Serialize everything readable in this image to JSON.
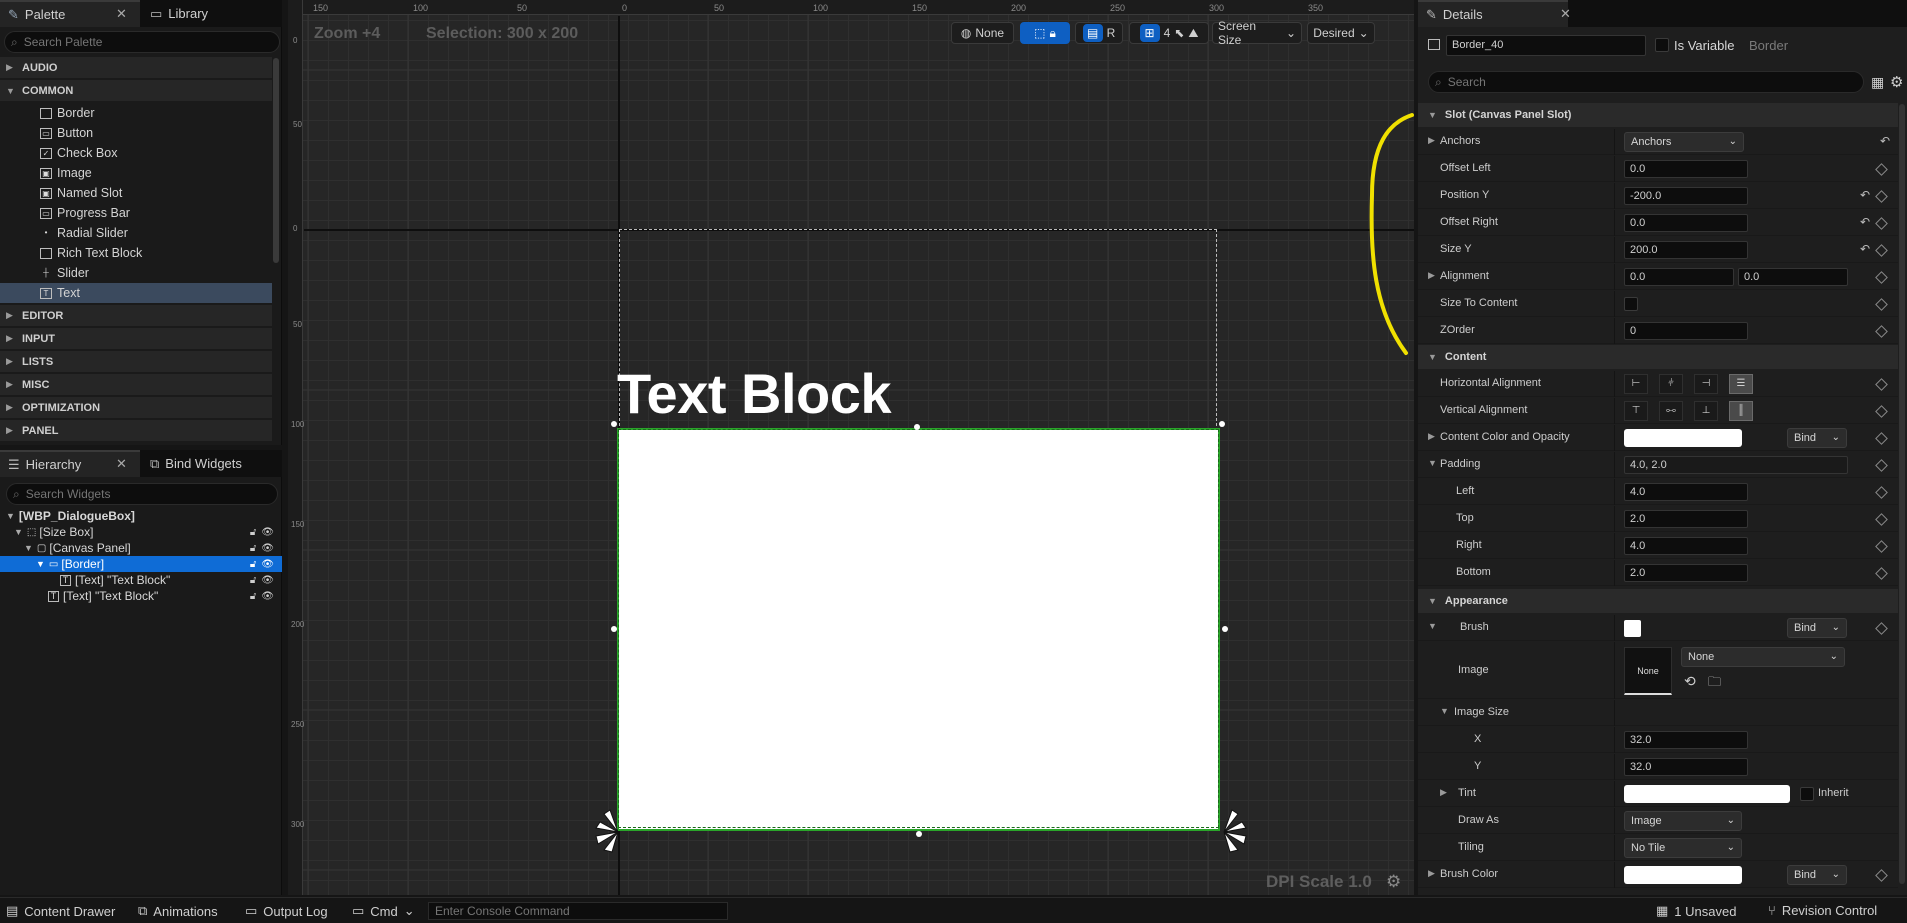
{
  "palette": {
    "tab_label": "Palette",
    "library_tab_label": "Library",
    "search_placeholder": "Search Palette",
    "categories_top": [
      "AUDIO",
      "COMMON"
    ],
    "common_items": [
      {
        "label": "Border",
        "icon": "border-icon"
      },
      {
        "label": "Button",
        "icon": "button-icon"
      },
      {
        "label": "Check Box",
        "icon": "checkbox-icon"
      },
      {
        "label": "Image",
        "icon": "image-icon"
      },
      {
        "label": "Named Slot",
        "icon": "named-slot-icon"
      },
      {
        "label": "Progress Bar",
        "icon": "progress-bar-icon"
      },
      {
        "label": "Radial Slider",
        "icon": "radial-slider-icon"
      },
      {
        "label": "Rich Text Block",
        "icon": "rich-text-icon"
      },
      {
        "label": "Slider",
        "icon": "slider-icon"
      },
      {
        "label": "Text",
        "icon": "text-icon"
      }
    ],
    "categories_bottom": [
      "EDITOR",
      "INPUT",
      "LISTS",
      "MISC",
      "OPTIMIZATION",
      "PANEL"
    ]
  },
  "hierarchy": {
    "tab_label": "Hierarchy",
    "bind_tab_label": "Bind Widgets",
    "search_placeholder": "Search Widgets",
    "rows": [
      {
        "label": "[WBP_DialogueBox]"
      },
      {
        "label": "[Size Box]"
      },
      {
        "label": "[Canvas Panel]"
      },
      {
        "label": "[Border]"
      },
      {
        "label": "[Text] \"Text Block\""
      },
      {
        "label": "[Text] \"Text Block\""
      }
    ]
  },
  "viewport": {
    "zoom": "Zoom +4",
    "selection": "Selection: 300 x 200",
    "ruler_top": [
      "150",
      "100",
      "50",
      "0",
      "50",
      "100",
      "150",
      "200",
      "250",
      "300",
      "350"
    ],
    "ruler_left": [
      "0",
      "50",
      "0",
      "50",
      "100",
      "150",
      "200",
      "250",
      "300"
    ],
    "toolbar": {
      "none_label": "None",
      "r_label": "R",
      "grid_value": "4",
      "screen_size": "Screen Size",
      "desired": "Desired"
    },
    "canvas_text": "Text Block",
    "dpi_scale": "DPI Scale 1.0"
  },
  "details": {
    "tab_label": "Details",
    "name_value": "Border_40",
    "is_variable_label": "Is Variable",
    "class_label": "Border",
    "search_placeholder": "Search",
    "slot_section": "Slot (Canvas Panel Slot)",
    "slot_rows": [
      {
        "label": "Anchors",
        "value": "Anchors"
      },
      {
        "label": "Offset Left",
        "value": "0.0"
      },
      {
        "label": "Position Y",
        "value": "-200.0"
      },
      {
        "label": "Offset Right",
        "value": "0.0"
      },
      {
        "label": "Size Y",
        "value": "200.0"
      },
      {
        "label": "Alignment",
        "value": "0.0",
        "value2": "0.0"
      },
      {
        "label": "Size To Content",
        "value": ""
      },
      {
        "label": "ZOrder",
        "value": "0"
      }
    ],
    "content_section": "Content",
    "content_rows": [
      {
        "label": "Horizontal Alignment"
      },
      {
        "label": "Vertical Alignment"
      },
      {
        "label": "Content Color and Opacity",
        "bind": "Bind"
      },
      {
        "label": "Padding",
        "value": "4.0, 2.0"
      },
      {
        "label": "Left",
        "value": "4.0"
      },
      {
        "label": "Top",
        "value": "2.0"
      },
      {
        "label": "Right",
        "value": "4.0"
      },
      {
        "label": "Bottom",
        "value": "2.0"
      }
    ],
    "appearance_section": "Appearance",
    "appearance_rows": {
      "brush_label": "Brush",
      "brush_bind": "Bind",
      "image_label": "Image",
      "image_thumb": "None",
      "image_combo": "None",
      "image_size_label": "Image Size",
      "x_label": "X",
      "x_value": "32.0",
      "y_label": "Y",
      "y_value": "32.0",
      "tint_label": "Tint",
      "inherit_label": "Inherit",
      "draw_as_label": "Draw As",
      "draw_as_value": "Image",
      "tiling_label": "Tiling",
      "tiling_value": "No Tile",
      "brush_color_label": "Brush Color",
      "brush_color_bind": "Bind"
    }
  },
  "bottombar": {
    "content_drawer": "Content Drawer",
    "animations": "Animations",
    "output_log": "Output Log",
    "cmd": "Cmd",
    "console_placeholder": "Enter Console Command",
    "unsaved": "1 Unsaved",
    "revision_control": "Revision Control"
  },
  "colors": {
    "selection_blue": "#0f6cd6",
    "selection_green": "#2aa52a",
    "annotation_yellow": "#f0e000"
  }
}
